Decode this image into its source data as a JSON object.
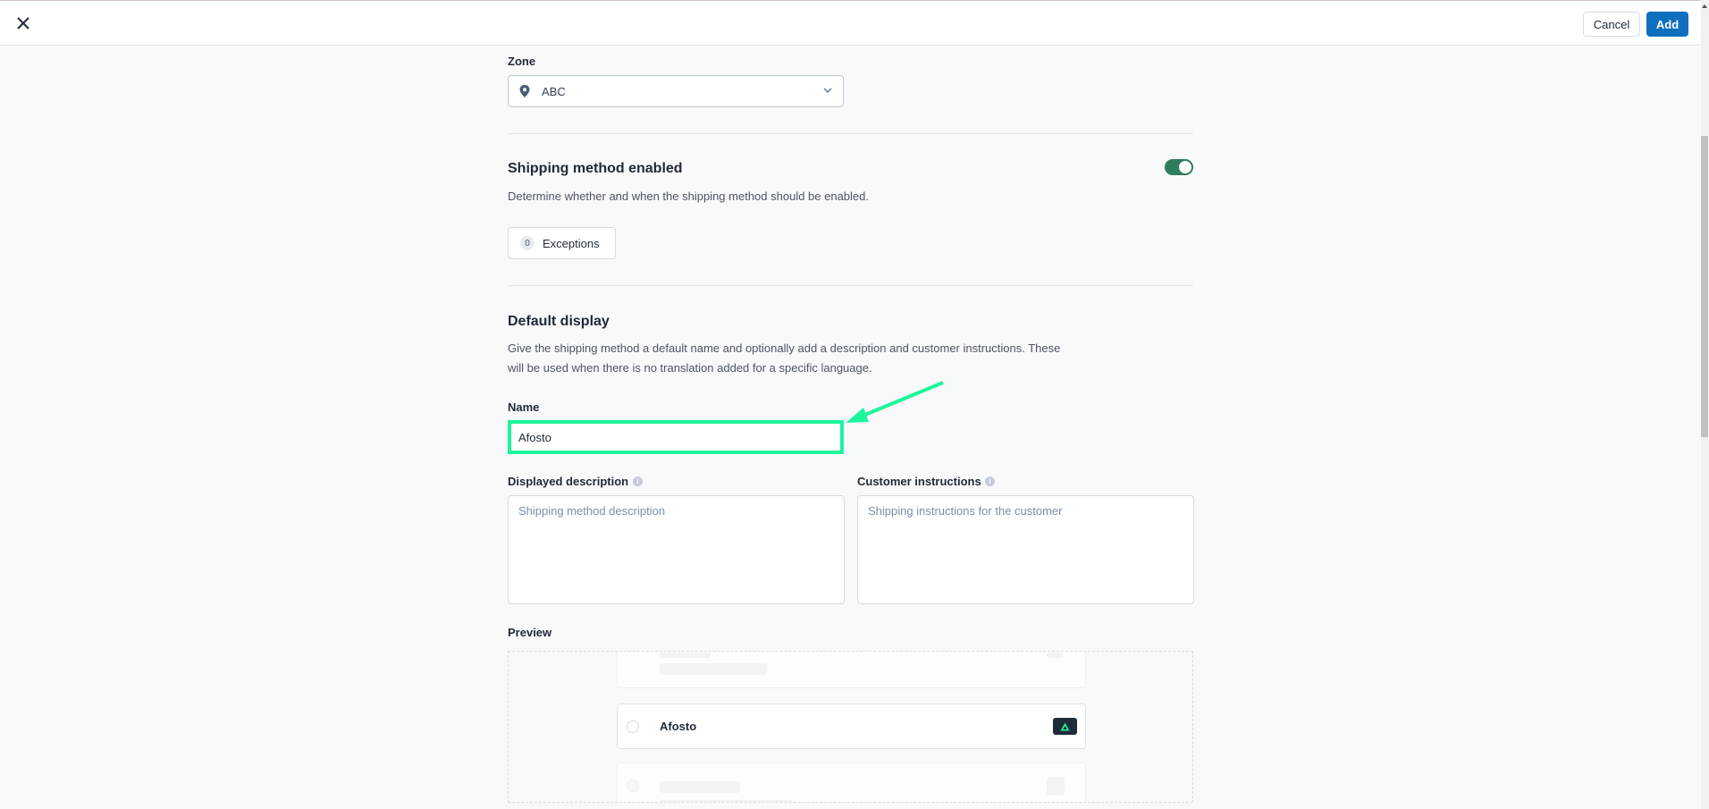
{
  "topbar": {
    "close_icon": "close-icon",
    "cancel_label": "Cancel",
    "add_label": "Add",
    "accent_color": "#0f6fbf"
  },
  "zone": {
    "label": "Zone",
    "value": "ABC",
    "icon": "map-pin-icon"
  },
  "shipping_enabled": {
    "title": "Shipping method enabled",
    "description": "Determine whether and when the shipping method should be enabled.",
    "enabled": true,
    "toggle_color": "#2e7d5b",
    "exceptions_count": "0",
    "exceptions_label": "Exceptions"
  },
  "default_display": {
    "title": "Default display",
    "description_line1": "Give the shipping method a default name and optionally add a description and customer instructions. These",
    "description_line2": "will be used when there is no translation added for a specific language.",
    "name_label": "Name",
    "name_value": "Afosto",
    "highlight_color": "#1ef59a",
    "description_label": "Displayed description",
    "description_placeholder": "Shipping method description",
    "instructions_label": "Customer instructions",
    "instructions_placeholder": "Shipping instructions for the customer"
  },
  "preview": {
    "label": "Preview",
    "item_title": "Afosto",
    "logo": "afosto-logo-icon"
  }
}
